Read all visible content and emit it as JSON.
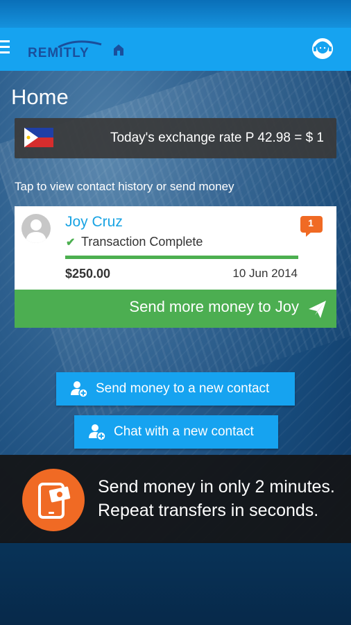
{
  "app": {
    "brand": "REMITLY"
  },
  "page": {
    "title": "Home"
  },
  "exchange": {
    "text": "Today's exchange rate P 42.98 = $ 1",
    "flag_icon": "philippines-flag-icon"
  },
  "hint": "Tap to view contact history or send money",
  "contact_card": {
    "name": "Joy Cruz",
    "status": "Transaction Complete",
    "badge_count": "1",
    "amount": "$250.00",
    "date": "10 Jun 2014",
    "progress": 1.0,
    "send_more_label": "Send more money to Joy"
  },
  "buttons": {
    "new_contact": "Send money to a new contact",
    "chat_new": "Chat with a new contact"
  },
  "promo": {
    "line1": "Send money in only 2 minutes.",
    "line2": "Repeat transfers in seconds."
  },
  "colors": {
    "accent": "#16a3f0",
    "brand_dark": "#1a4f9c",
    "success": "#4cae51",
    "badge": "#f06a24",
    "promo_icon": "#f06a24"
  },
  "icons": [
    "menu-icon",
    "support-agent-icon",
    "paper-plane-icon",
    "add-contact-icon",
    "chat-contact-icon",
    "phone-money-icon",
    "chat-badge-icon",
    "avatar-icon",
    "check-icon"
  ]
}
